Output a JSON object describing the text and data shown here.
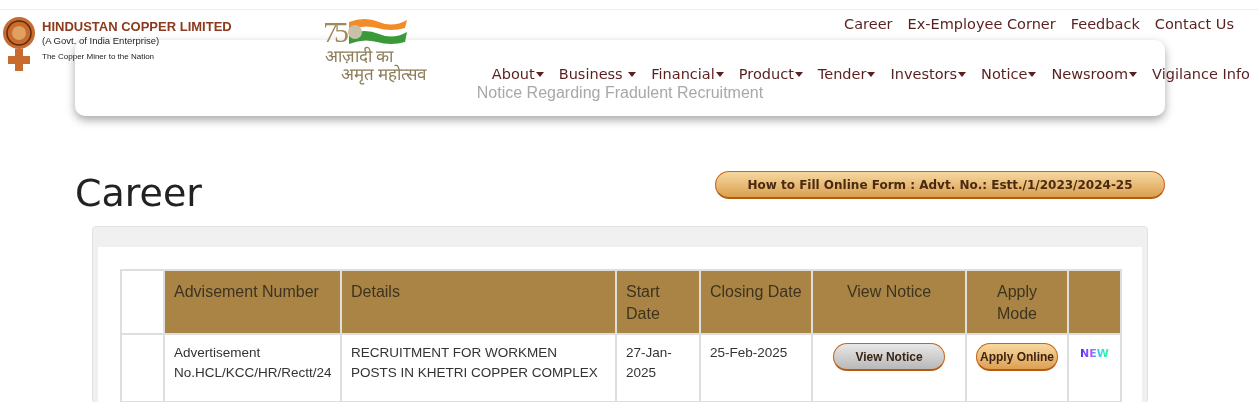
{
  "header": {
    "company": {
      "name": "HINDUSTAN COPPER LIMITED",
      "subtitle": "(A Govt. of India Enterprise)",
      "tagline": "The Copper Miner to the Nation"
    },
    "azadi_logo": {
      "number": "75",
      "line_1": "आज़ादी का",
      "line_2": "अमृत महोत्सव"
    },
    "top_links": [
      "Career",
      "Ex-Employee Corner",
      "Feedback",
      "Contact Us"
    ],
    "nav": [
      {
        "label": "About",
        "dropdown": true
      },
      {
        "label": "Business ",
        "dropdown": true
      },
      {
        "label": "Financial",
        "dropdown": true
      },
      {
        "label": "Product",
        "dropdown": true
      },
      {
        "label": "Tender",
        "dropdown": true
      },
      {
        "label": "Investors",
        "dropdown": true
      },
      {
        "label": "Notice",
        "dropdown": true
      },
      {
        "label": "Newsroom",
        "dropdown": true
      },
      {
        "label": "Vigilance Info",
        "dropdown": false
      }
    ]
  },
  "notice_banner": "Notice Regarding Fradulent Recruitment",
  "page_title": "Career",
  "help_button": "How to Fill Online Form : Advt. No.: Estt./1/2023/2024-25",
  "table": {
    "columns": [
      "Advisement Number",
      "Details",
      "Start Date",
      "Closing Date",
      "View Notice",
      "Apply Mode"
    ],
    "rows": [
      {
        "advertisement": "Advertisement No.HCL/KCC/HR/Rectt/24",
        "details": "RECRUITMENT FOR WORKMEN POSTS IN KHETRI COPPER COMPLEX",
        "start_date": "27-Jan-2025",
        "closing_date": "25-Feb-2025",
        "view_button": "View Notice",
        "apply_button": "Apply Online",
        "badge": "NEW"
      }
    ]
  }
}
